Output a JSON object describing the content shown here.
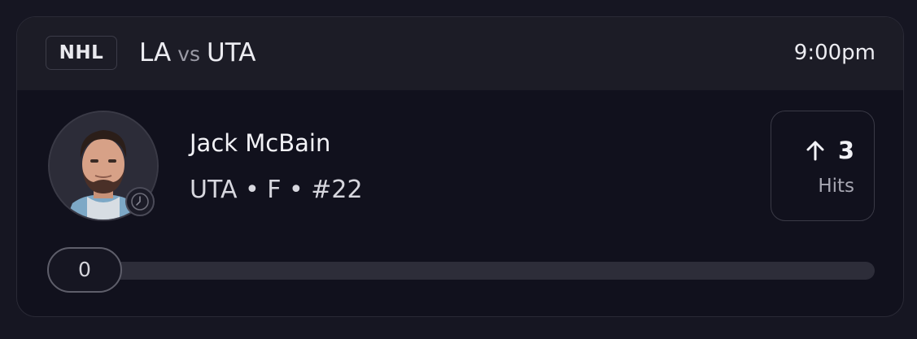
{
  "header": {
    "league": "NHL",
    "away_team": "LA",
    "vs": "vs",
    "home_team": "UTA",
    "time": "9:00pm"
  },
  "player": {
    "name": "Jack McBain",
    "meta": "UTA • F • #22",
    "avatar_icon": "player-photo",
    "status_icon": "clock-icon"
  },
  "stat": {
    "direction_icon": "up-arrow-icon",
    "value": "3",
    "label": "Hits"
  },
  "progress": {
    "current_label": "0",
    "current": 0
  },
  "colors": {
    "background": "#161622",
    "card": "#11111d",
    "header": "#1c1c26",
    "track": "#2d2d39"
  }
}
